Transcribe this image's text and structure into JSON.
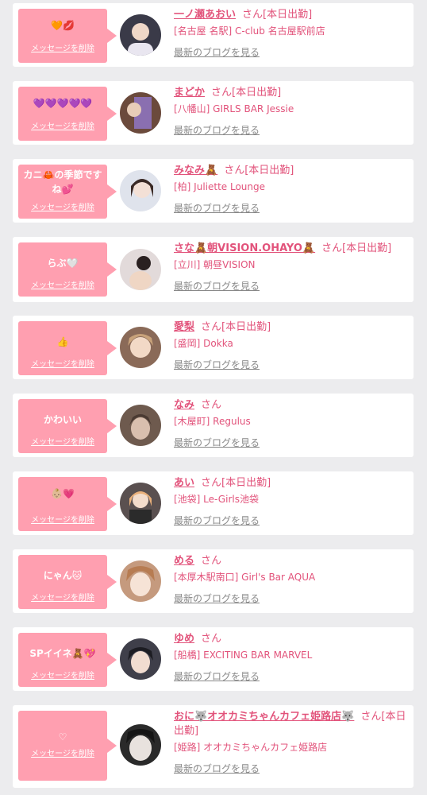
{
  "delete_label": "メッセージを削除",
  "blog_label": "最新のブログを見る",
  "san": "さん",
  "items": [
    {
      "msg": "🧡💋",
      "name": "一ノ瀬あおい",
      "status": "[本日出勤]",
      "shop": "[名古屋 名駅] C-club 名古屋駅前店",
      "avatar_color": "#3a3a48"
    },
    {
      "msg": "💜💜💜💜💜",
      "name": "まどか",
      "status": "[本日出勤]",
      "shop": "[八幡山] GIRLS BAR Jessie",
      "avatar_color": "#6b4a3c"
    },
    {
      "msg": "カニ🦀の季節ですね💕",
      "name": "みなみ🧸",
      "status": "[本日出勤]",
      "shop": "[柏] Juliette Lounge",
      "avatar_color": "#d9dce6"
    },
    {
      "msg": "らぶ🤍",
      "name": "さな🧸朝VISION.OHAYO🧸",
      "status": "[本日出勤]",
      "shop": "[立川] 朝昼VISION",
      "avatar_color": "#d8cfcf"
    },
    {
      "msg": "👍",
      "name": "愛梨",
      "status": "[本日出勤]",
      "shop": "[盛岡] Dokka",
      "avatar_color": "#b9927a"
    },
    {
      "msg": "かわいい",
      "name": "なみ",
      "status": "",
      "shop": "[木屋町] Regulus",
      "avatar_color": "#6e5a4e"
    },
    {
      "msg": "👶🏼💗",
      "name": "あい",
      "status": "[本日出勤]",
      "shop": "[池袋] Le-Girls池袋",
      "avatar_color": "#5a5050"
    },
    {
      "msg": "にゃん🐱",
      "name": "める",
      "status": "",
      "shop": "[本厚木駅南口] Girl's Bar AQUA",
      "avatar_color": "#c59a7e"
    },
    {
      "msg": "SPイイネ🧸💖",
      "name": "ゆめ",
      "status": "",
      "shop": "[船橋] EXCITING BAR MARVEL",
      "avatar_color": "#3f3f4a"
    },
    {
      "msg": "♡",
      "name": "おに🐺オオカミちゃんカフェ姫路店🐺",
      "status": "[本日出勤]",
      "shop": "[姫路] オオカミちゃんカフェ姫路店",
      "avatar_color": "#2a2a2a"
    }
  ]
}
